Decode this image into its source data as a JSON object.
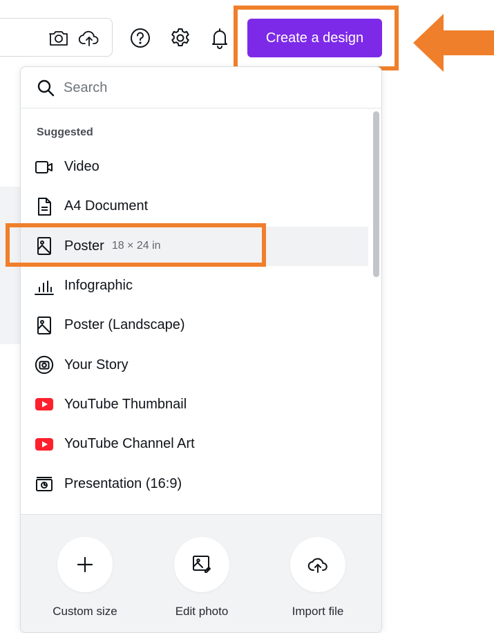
{
  "header": {
    "create_button_label": "Create a design",
    "bar_icons": [
      "camera-icon",
      "cloud-upload-icon"
    ],
    "icons": [
      "help-icon",
      "settings-icon",
      "notifications-icon"
    ],
    "accent_color": "#7d2ae8",
    "highlight_color": "#f07f2b"
  },
  "dropdown": {
    "search_placeholder": "Search",
    "section_label": "Suggested",
    "items": [
      {
        "label": "Video",
        "dims": "",
        "icon": "video-icon"
      },
      {
        "label": "A4 Document",
        "dims": "",
        "icon": "document-icon"
      },
      {
        "label": "Poster",
        "dims": "18 × 24 in",
        "icon": "poster-icon"
      },
      {
        "label": "Infographic",
        "dims": "",
        "icon": "infographic-icon"
      },
      {
        "label": "Poster (Landscape)",
        "dims": "",
        "icon": "poster-icon"
      },
      {
        "label": "Your Story",
        "dims": "",
        "icon": "story-icon"
      },
      {
        "label": "YouTube Thumbnail",
        "dims": "",
        "icon": "youtube-icon"
      },
      {
        "label": "YouTube Channel Art",
        "dims": "",
        "icon": "youtube-icon"
      },
      {
        "label": "Presentation (16:9)",
        "dims": "",
        "icon": "presentation-icon"
      }
    ],
    "actions": [
      {
        "label": "Custom size",
        "icon": "plus-icon"
      },
      {
        "label": "Edit photo",
        "icon": "edit-photo-icon"
      },
      {
        "label": "Import file",
        "icon": "cloud-upload-icon"
      }
    ]
  }
}
